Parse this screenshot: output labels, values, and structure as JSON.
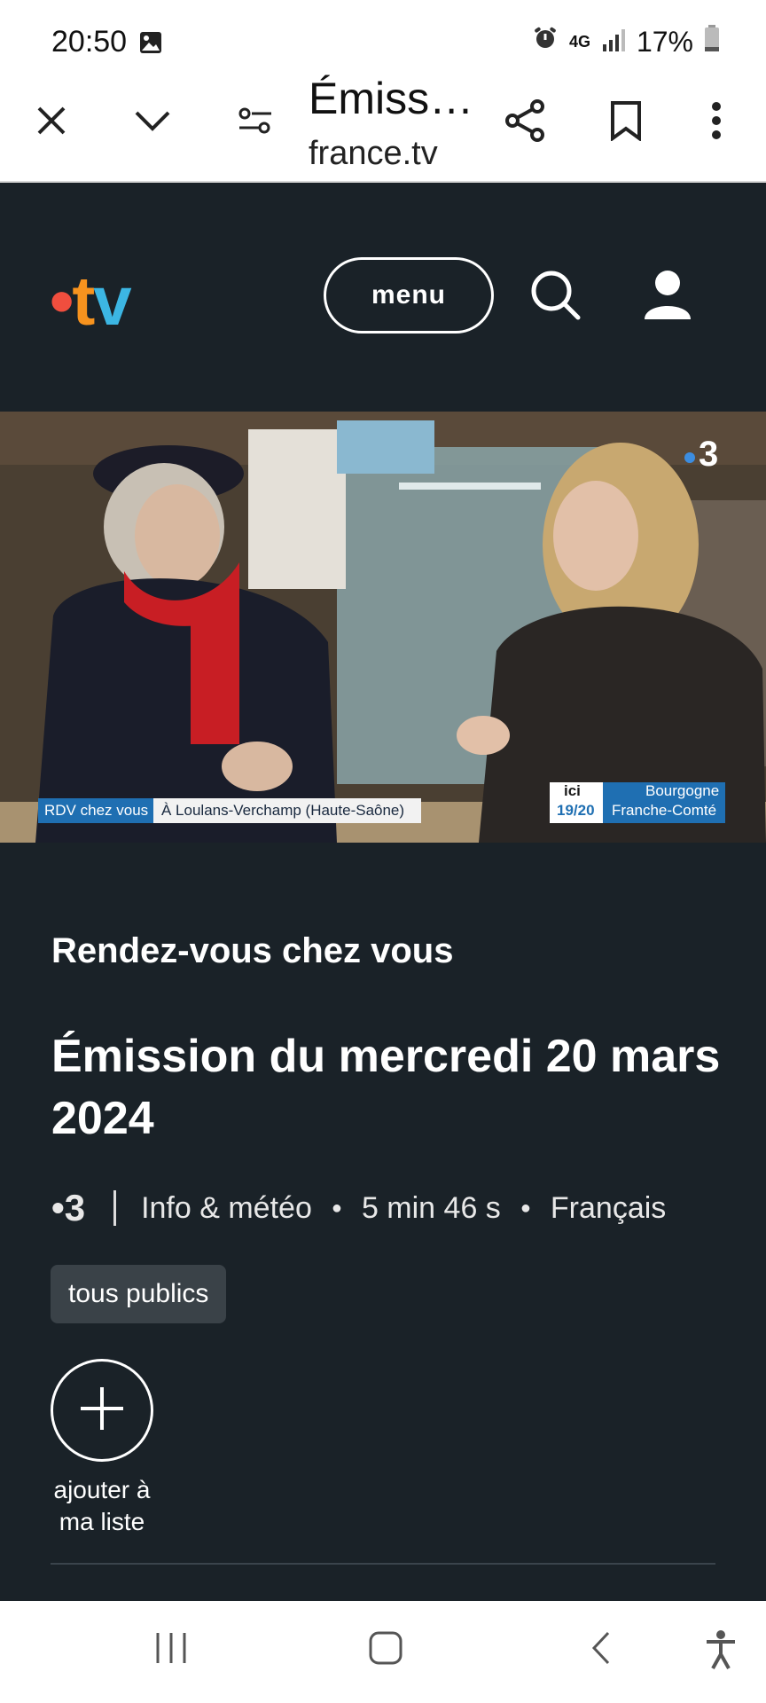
{
  "status": {
    "time": "20:50",
    "network": "4G",
    "battery": "17%"
  },
  "toolbar": {
    "title": "Émissi…",
    "domain": "france.tv"
  },
  "header": {
    "menu_label": "menu"
  },
  "video": {
    "channel_badge": "3",
    "caption_left_1": "RDV chez vous",
    "caption_left_2": "À Loulans-Verchamp (Haute-Saône)",
    "caption_brand": "ici",
    "caption_time": "19/20",
    "caption_region_1": "Bourgogne",
    "caption_region_2": "Franche-Comté"
  },
  "program": {
    "name": "Rendez-vous chez vous",
    "episode_title": "Émission du mercredi 20 mars 2024",
    "channel": "3",
    "genre": "Info & météo",
    "duration": "5 min 46 s",
    "language": "Français",
    "rating": "tous publics",
    "add_label_line1": "ajouter à",
    "add_label_line2": "ma liste"
  },
  "colors": {
    "background": "#1a2228",
    "logo_dot": "#f04e3e",
    "logo_t": "#f7931e",
    "logo_v": "#3cb6e3"
  }
}
